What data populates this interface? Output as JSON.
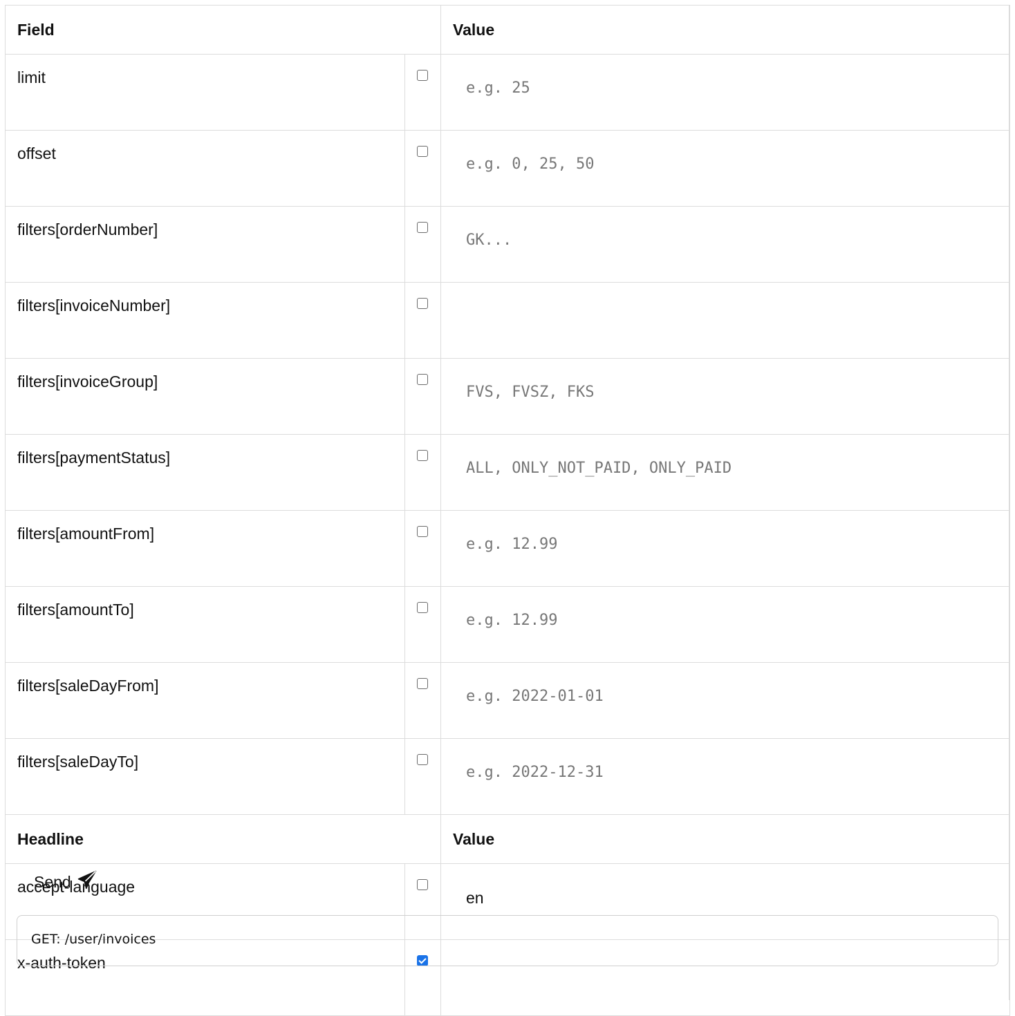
{
  "params_header": {
    "field": "Field",
    "value": "Value"
  },
  "params": [
    {
      "name": "limit",
      "checked": false,
      "placeholder": "e.g. 25",
      "value": ""
    },
    {
      "name": "offset",
      "checked": false,
      "placeholder": "e.g. 0, 25, 50",
      "value": ""
    },
    {
      "name": "filters[orderNumber]",
      "checked": false,
      "placeholder": "GK...",
      "value": ""
    },
    {
      "name": "filters[invoiceNumber]",
      "checked": false,
      "placeholder": "",
      "value": ""
    },
    {
      "name": "filters[invoiceGroup]",
      "checked": false,
      "placeholder": "FVS, FVSZ, FKS",
      "value": ""
    },
    {
      "name": "filters[paymentStatus]",
      "checked": false,
      "placeholder": "ALL, ONLY_NOT_PAID, ONLY_PAID",
      "value": ""
    },
    {
      "name": "filters[amountFrom]",
      "checked": false,
      "placeholder": "e.g. 12.99",
      "value": ""
    },
    {
      "name": "filters[amountTo]",
      "checked": false,
      "placeholder": "e.g. 12.99",
      "value": ""
    },
    {
      "name": "filters[saleDayFrom]",
      "checked": false,
      "placeholder": "e.g. 2022-01-01",
      "value": ""
    },
    {
      "name": "filters[saleDayTo]",
      "checked": false,
      "placeholder": "e.g. 2022-12-31",
      "value": ""
    }
  ],
  "headers_header": {
    "headline": "Headline",
    "value": "Value"
  },
  "headers": [
    {
      "name": "accept-language",
      "checked": false,
      "placeholder": "",
      "value": "en"
    },
    {
      "name": "x-auth-token",
      "checked": true,
      "placeholder": "",
      "value": ""
    }
  ],
  "send": {
    "label": "Send",
    "icon": "paper-plane-icon"
  },
  "request": {
    "line": "GET: /user/invoices"
  },
  "colors": {
    "checkbox_checked": "#1a73e8",
    "border": "#dcdcdc",
    "placeholder": "#777777"
  }
}
